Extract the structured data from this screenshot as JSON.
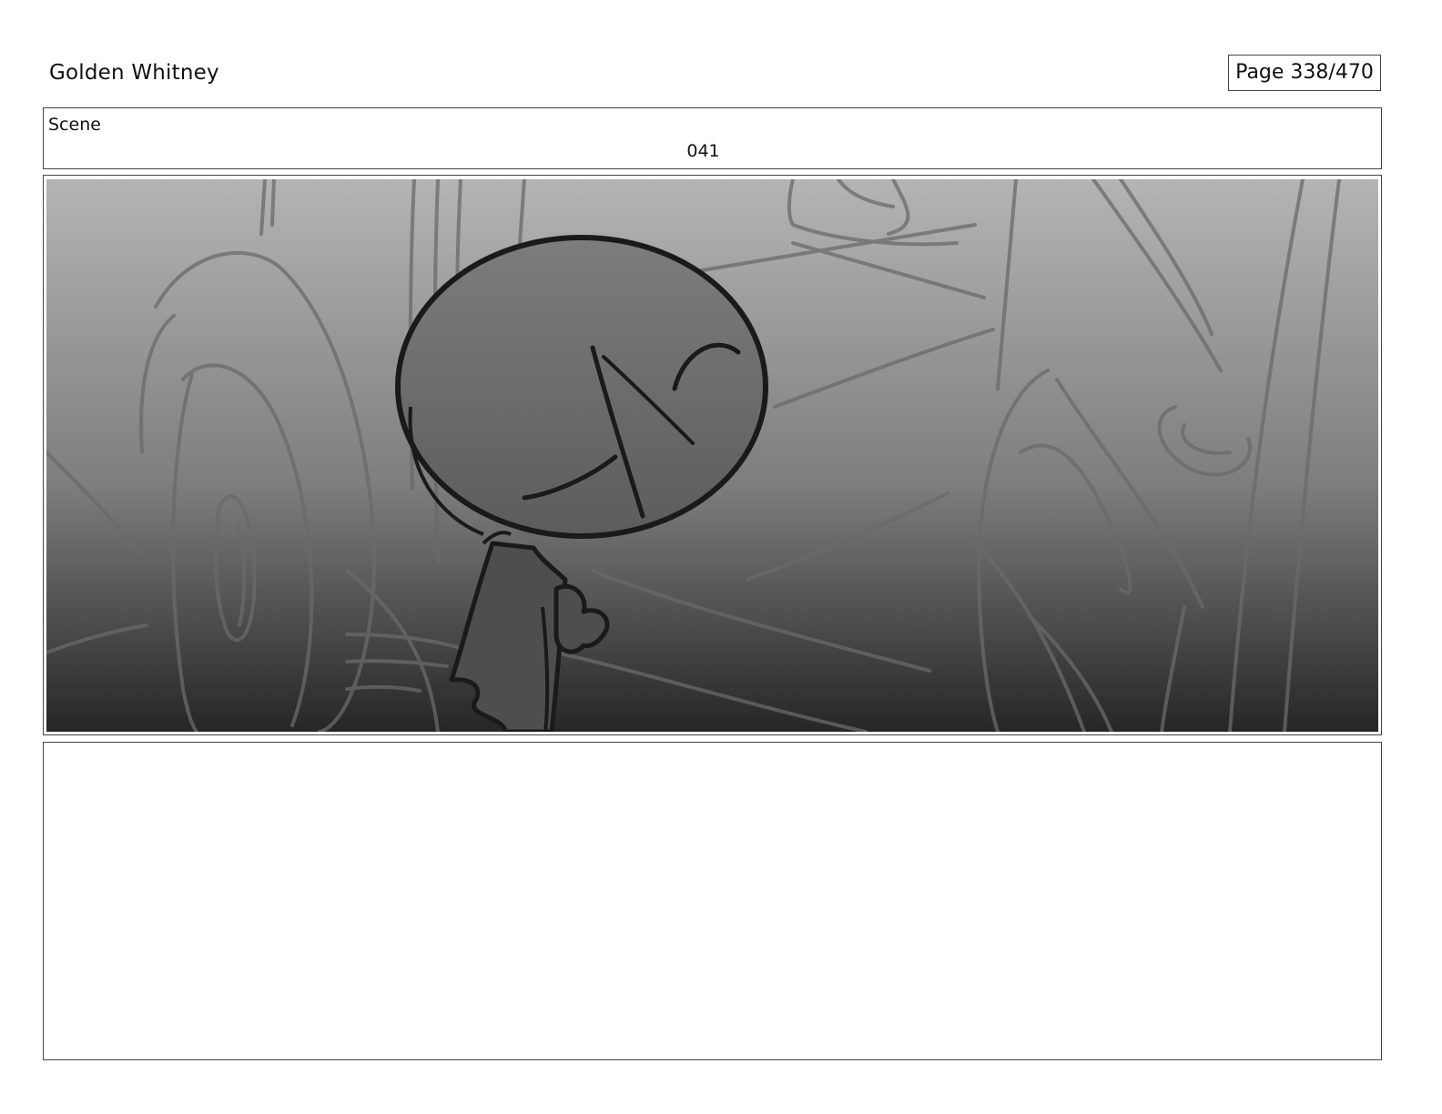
{
  "header": {
    "title": "Golden Whitney",
    "page_indicator": "Page 338/470"
  },
  "scene": {
    "label": "Scene",
    "number": "041"
  },
  "panel": {
    "content": "storyboard-sketch-frame",
    "gradient_top": "#b4b4b4",
    "gradient_bottom": "#262626"
  },
  "notes": {
    "text": ""
  }
}
